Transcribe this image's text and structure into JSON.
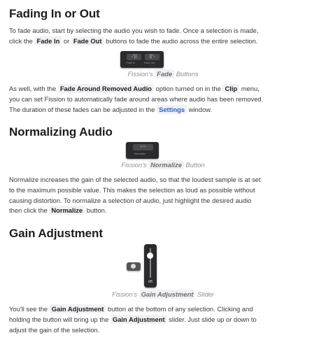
{
  "sections": [
    {
      "title": "Fading In or Out"
    },
    {
      "title": "Normalizing Audio"
    },
    {
      "title": "Gain Adjustment"
    }
  ],
  "paragraphs": {
    "fade_intro": [
      [
        {
          "t": "To fade audio, start by selecting the audio you wish to fade. Once a selection is made,"
        }
      ],
      [
        {
          "t": "click the "
        },
        {
          "t": "Fade In",
          "k": "code"
        },
        {
          "t": " or "
        },
        {
          "t": "Fade Out",
          "k": "code"
        },
        {
          "t": " buttons to fade the audio across the entire selection."
        }
      ]
    ],
    "fade_removed": [
      [
        {
          "t": "As well, with the "
        },
        {
          "t": "Fade Around Removed Audio",
          "k": "code"
        },
        {
          "t": " option turned on in the "
        },
        {
          "t": "Clip",
          "k": "code"
        },
        {
          "t": " menu,"
        }
      ],
      [
        {
          "t": "you can set Fission to automatically fade around areas where audio has been removed."
        }
      ],
      [
        {
          "t": "The duration of these fades can be adjusted in the "
        },
        {
          "t": "Settings",
          "k": "link"
        },
        {
          "t": " window."
        }
      ]
    ],
    "normalize": [
      [
        {
          "t": "Normalize increases the gain of the selected audio, so that the loudest sample is at set"
        }
      ],
      [
        {
          "t": "to the maximum possible value. This makes the selection as loud as possible without"
        }
      ],
      [
        {
          "t": "causing distortion. To normalize a selection of audio, just highlight the desired audio"
        }
      ],
      [
        {
          "t": "then click the "
        },
        {
          "t": "Normalize",
          "k": "code"
        },
        {
          "t": " button."
        }
      ]
    ],
    "gain": [
      [
        {
          "t": "You'll see the "
        },
        {
          "t": "Gain Adjustment",
          "k": "code"
        },
        {
          "t": " button at the bottom of any selection. Clicking and"
        }
      ],
      [
        {
          "t": "holding the button will bring up the "
        },
        {
          "t": "Gain Adjustment",
          "k": "code"
        },
        {
          "t": " slider. Just slide up or down to"
        }
      ],
      [
        {
          "t": "adjust the gain of the selection."
        }
      ]
    ]
  },
  "captions": {
    "fade": {
      "pre": "Fission's ",
      "code": "Fade",
      "post": " Buttons"
    },
    "normalize": {
      "pre": "Fission's ",
      "code": "Normalize",
      "post": " Button"
    },
    "gain": {
      "pre": "Fission's ",
      "code": "Gain Adjustment",
      "post": " Slider"
    }
  },
  "images": {
    "fade_in_label": "Fade In",
    "fade_out_label": "Fade Out",
    "normalize_label": "Normalize",
    "slider_unit": "dB",
    "gain_slider_level": 0.85
  }
}
